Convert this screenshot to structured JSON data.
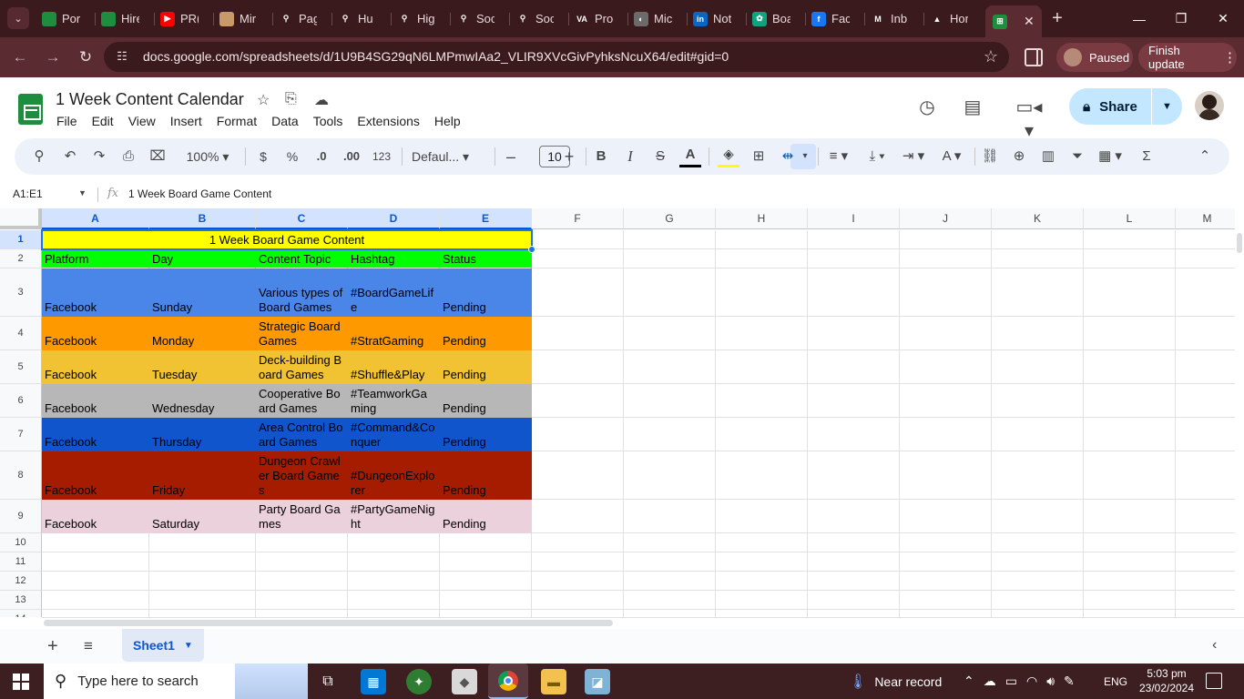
{
  "browser": {
    "tabs": [
      {
        "title": "Por",
        "icon": "sheets-icon",
        "color": "#1e8e3e",
        "glyph": ""
      },
      {
        "title": "Hire",
        "icon": "sheets-icon",
        "color": "#1e8e3e",
        "glyph": ""
      },
      {
        "title": "PR(",
        "icon": "youtube-icon",
        "color": "#ff0000",
        "glyph": "▶"
      },
      {
        "title": "Mir",
        "icon": "photo-icon",
        "color": "#c89a6a",
        "glyph": ""
      },
      {
        "title": "Pag",
        "icon": "runner-icon",
        "color": "#3b1a1e",
        "glyph": "⚲"
      },
      {
        "title": "Hu",
        "icon": "runner-icon",
        "color": "#3b1a1e",
        "glyph": "⚲"
      },
      {
        "title": "Hig",
        "icon": "runner-icon",
        "color": "#3b1a1e",
        "glyph": "⚲"
      },
      {
        "title": "Soc",
        "icon": "runner-icon",
        "color": "#3b1a1e",
        "glyph": "⚲"
      },
      {
        "title": "Soc",
        "icon": "runner-icon",
        "color": "#3b1a1e",
        "glyph": "⚲"
      },
      {
        "title": "Pro",
        "icon": "va-icon",
        "color": "#3b1a1e",
        "glyph": "VA"
      },
      {
        "title": "Mic",
        "icon": "globe-icon",
        "color": "#6b6b6b",
        "glyph": "◐"
      },
      {
        "title": "Not",
        "icon": "linkedin-icon",
        "color": "#0a66c2",
        "glyph": "in"
      },
      {
        "title": "Boa",
        "icon": "chatgpt-icon",
        "color": "#10a37f",
        "glyph": "✿"
      },
      {
        "title": "Fac",
        "icon": "facebook-icon",
        "color": "#1877f2",
        "glyph": "f"
      },
      {
        "title": "Inb",
        "icon": "gmail-icon",
        "color": "#3b1a1e",
        "glyph": "M"
      },
      {
        "title": "Hor",
        "icon": "drive-icon",
        "color": "#3b1a1e",
        "glyph": "▲"
      }
    ],
    "active_tab_icon": "sheets-icon",
    "url": "docs.google.com/spreadsheets/d/1U9B4SG29qN6LMPmwIAa2_VLIR9XVcGivPyhksNcuX64/edit#gid=0",
    "profile_label": "Paused",
    "update_label": "Finish update"
  },
  "doc": {
    "title": "1 Week Content Calendar",
    "menu": [
      "File",
      "Edit",
      "View",
      "Insert",
      "Format",
      "Data",
      "Tools",
      "Extensions",
      "Help"
    ],
    "share_label": "Share"
  },
  "toolbar": {
    "zoom": "100%",
    "currency": "$",
    "percent": "%",
    "dec_decrease": ".0",
    "dec_increase": ".00",
    "number_format": "123",
    "font": "Defaul...",
    "font_size": "10"
  },
  "formula": {
    "name_box": "A1:E1",
    "value": "1 Week Board Game Content"
  },
  "grid": {
    "columns": [
      "A",
      "B",
      "C",
      "D",
      "E",
      "F",
      "G",
      "H",
      "I",
      "J",
      "K",
      "L",
      "M"
    ],
    "selected_columns": [
      "A",
      "B",
      "C",
      "D",
      "E"
    ],
    "rows": [
      "1",
      "2",
      "3",
      "4",
      "5",
      "6",
      "7",
      "8",
      "9",
      "10",
      "11",
      "12",
      "13",
      "14"
    ],
    "title_row": "1 Week Board Game Content",
    "header": [
      "Platform",
      "Day",
      "Content Topic",
      "Hashtag",
      "Status"
    ],
    "data": [
      {
        "bg": "#4a86e8",
        "cells": [
          "Facebook",
          "Sunday",
          "Various types of Board Games",
          "#BoardGameLife",
          "Pending"
        ]
      },
      {
        "bg": "#ff9900",
        "cells": [
          "Facebook",
          "Monday",
          "Strategic Board Games",
          "#StratGaming",
          "Pending"
        ]
      },
      {
        "bg": "#f1c232",
        "cells": [
          "Facebook",
          "Tuesday",
          "Deck-building Board Games",
          "#Shuffle&Play",
          "Pending"
        ]
      },
      {
        "bg": "#b7b7b7",
        "cells": [
          "Facebook",
          "Wednesday",
          "Cooperative Board Games",
          "#TeamworkGaming",
          "Pending"
        ]
      },
      {
        "bg": "#1155cc",
        "cells": [
          "Facebook",
          "Thursday",
          "Area Control Board Games",
          "#Command&Conquer",
          "Pending"
        ]
      },
      {
        "bg": "#a61c00",
        "cells": [
          "Facebook",
          "Friday",
          "Dungeon Crawler Board Games",
          "#DungeonExplorer",
          "Pending"
        ]
      },
      {
        "bg": "#ead1dc",
        "cells": [
          "Facebook",
          "Saturday",
          "Party Board Games",
          "#PartyGameNight",
          "Pending"
        ]
      }
    ],
    "header_bg": "#00ff00",
    "title_bg": "#ffff00"
  },
  "sheets": {
    "active": "Sheet1"
  },
  "taskbar": {
    "search_placeholder": "Type here to search",
    "weather": "Near record",
    "lang": "ENG",
    "time": "5:03 pm",
    "date": "23/02/2024"
  }
}
